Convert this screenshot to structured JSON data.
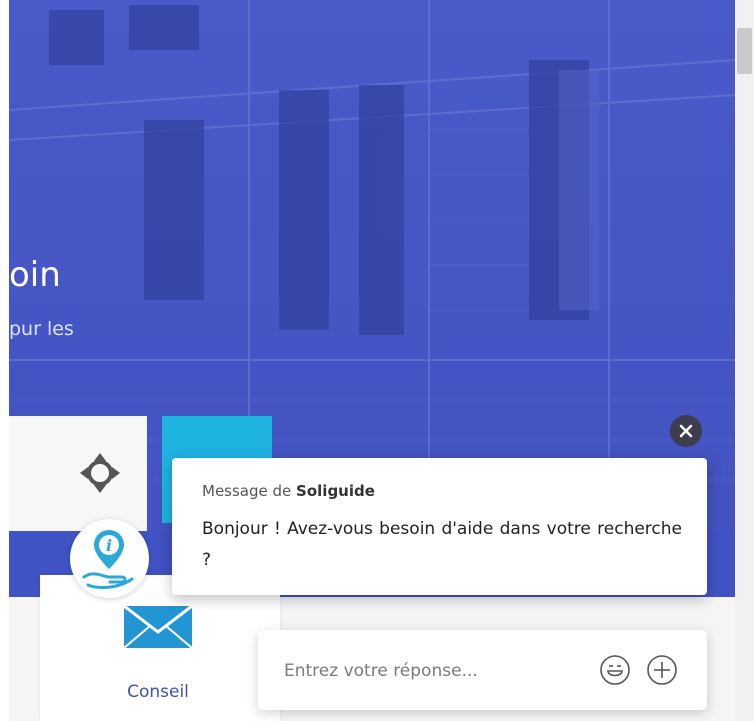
{
  "hero": {
    "title_fragment": "oin",
    "subtitle_fragment": "pur les"
  },
  "service_card": {
    "icon": "envelope-icon",
    "label": "Conseil"
  },
  "chat": {
    "header_prefix": "Message de",
    "sender": "Soliguide",
    "message": "Bonjour ! Avez-vous besoin d'aide dans votre recherche ?",
    "reply_placeholder": "Entrez votre réponse...",
    "icons": {
      "close": "close-icon",
      "emoji": "smiley-icon",
      "add": "plus-icon",
      "avatar": "info-pin-hand-icon"
    }
  },
  "colors": {
    "hero_overlay": "#4a5bc9",
    "accent_blue": "#3f51b5",
    "cyan": "#1fb3df",
    "close_button": "#3d3d4e"
  }
}
